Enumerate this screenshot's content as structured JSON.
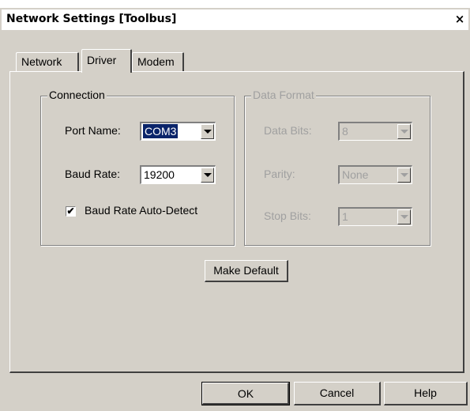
{
  "window": {
    "title": "Network Settings [Toolbus]",
    "close_glyph": "×"
  },
  "tabs": [
    {
      "label": "Network",
      "active": false
    },
    {
      "label": "Driver",
      "active": true
    },
    {
      "label": "Modem",
      "active": false
    }
  ],
  "connection": {
    "title": "Connection",
    "port_name_label": "Port Name:",
    "port_name_value": "COM3",
    "baud_rate_label": "Baud Rate:",
    "baud_rate_value": "19200",
    "auto_detect_label": "Baud Rate Auto-Detect",
    "auto_detect_checked": true,
    "check_glyph": "✔"
  },
  "data_format": {
    "title": "Data Format",
    "data_bits_label": "Data Bits:",
    "data_bits_value": "8",
    "parity_label": "Parity:",
    "parity_value": "None",
    "stop_bits_label": "Stop Bits:",
    "stop_bits_value": "1"
  },
  "buttons": {
    "make_default": "Make Default",
    "ok": "OK",
    "cancel": "Cancel",
    "help": "Help"
  },
  "colors": {
    "face": "#d4d0c8",
    "selection": "#0a246a"
  }
}
